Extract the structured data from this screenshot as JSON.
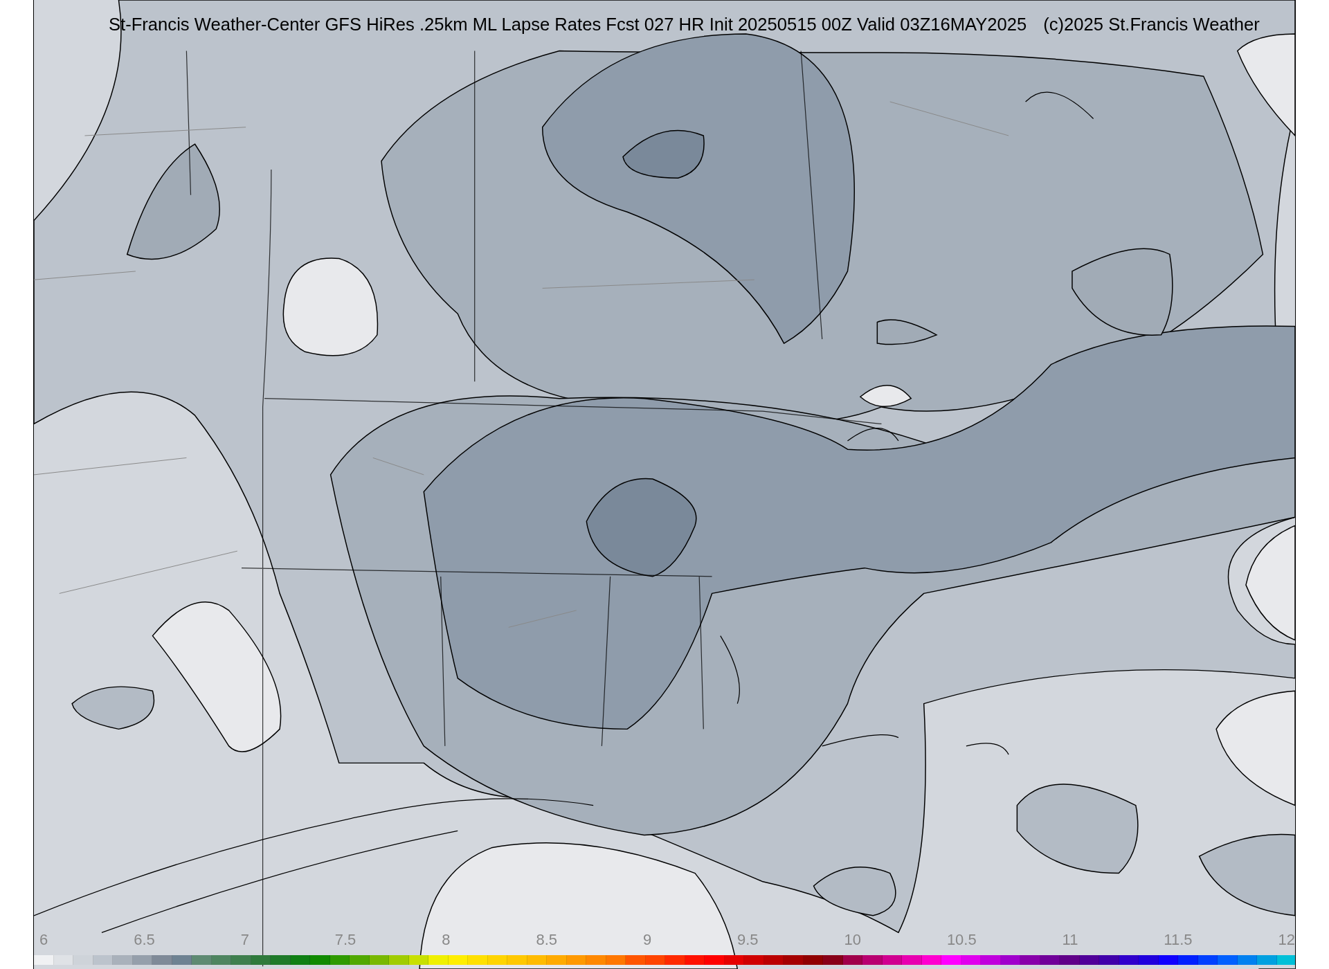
{
  "title": {
    "main": "St-Francis Weather-Center GFS HiRes .25km ML Lapse Rates  Fcst 027 HR Init 20250515 00Z  Valid 03Z16MAY2025",
    "credit": "(c)2025 St.Francis Weather"
  },
  "colorbar": {
    "ticks": [
      "6",
      "6.5",
      "7",
      "7.5",
      "8",
      "8.5",
      "9",
      "9.5",
      "10",
      "10.5",
      "11",
      "11.5",
      "12"
    ],
    "segments": [
      {
        "color": "#f0f1f3"
      },
      {
        "color": "#dfe2e6"
      },
      {
        "color": "#ced3d9"
      },
      {
        "color": "#bcc3cc"
      },
      {
        "color": "#a9b1bb"
      },
      {
        "color": "#959fab"
      },
      {
        "color": "#7f8a98"
      },
      {
        "color": "#6e8292"
      },
      {
        "color": "#5e8a72"
      },
      {
        "color": "#4e8560"
      },
      {
        "color": "#3f7f4e"
      },
      {
        "color": "#2f7a3c"
      },
      {
        "color": "#1f7a2a"
      },
      {
        "color": "#0f7f14"
      },
      {
        "color": "#108a00"
      },
      {
        "color": "#2f9a00"
      },
      {
        "color": "#50a800"
      },
      {
        "color": "#78b800"
      },
      {
        "color": "#a0cc00"
      },
      {
        "color": "#c8e000"
      },
      {
        "color": "#f0f000"
      },
      {
        "color": "#ffee00"
      },
      {
        "color": "#ffe000"
      },
      {
        "color": "#ffd400"
      },
      {
        "color": "#ffc800"
      },
      {
        "color": "#ffbb00"
      },
      {
        "color": "#ffaa00"
      },
      {
        "color": "#ff9900"
      },
      {
        "color": "#ff8800"
      },
      {
        "color": "#ff7700"
      },
      {
        "color": "#ff5500"
      },
      {
        "color": "#ff4400"
      },
      {
        "color": "#ff2a00"
      },
      {
        "color": "#ff1100"
      },
      {
        "color": "#ff0000"
      },
      {
        "color": "#e60000"
      },
      {
        "color": "#d00000"
      },
      {
        "color": "#bb0000"
      },
      {
        "color": "#a50000"
      },
      {
        "color": "#900000"
      },
      {
        "color": "#880018"
      },
      {
        "color": "#a0004a"
      },
      {
        "color": "#b80070"
      },
      {
        "color": "#d00090"
      },
      {
        "color": "#e800b0"
      },
      {
        "color": "#ff00d0"
      },
      {
        "color": "#ff00ff"
      },
      {
        "color": "#e000ee"
      },
      {
        "color": "#c000dd"
      },
      {
        "color": "#a000cc"
      },
      {
        "color": "#8800aa"
      },
      {
        "color": "#700099"
      },
      {
        "color": "#600088"
      },
      {
        "color": "#500099"
      },
      {
        "color": "#4000aa"
      },
      {
        "color": "#3000cc"
      },
      {
        "color": "#2000dd"
      },
      {
        "color": "#1000ff"
      },
      {
        "color": "#0020ff"
      },
      {
        "color": "#0040ff"
      },
      {
        "color": "#0060ff"
      },
      {
        "color": "#0080f0"
      },
      {
        "color": "#00a0e0"
      },
      {
        "color": "#00c0d8"
      }
    ]
  }
}
